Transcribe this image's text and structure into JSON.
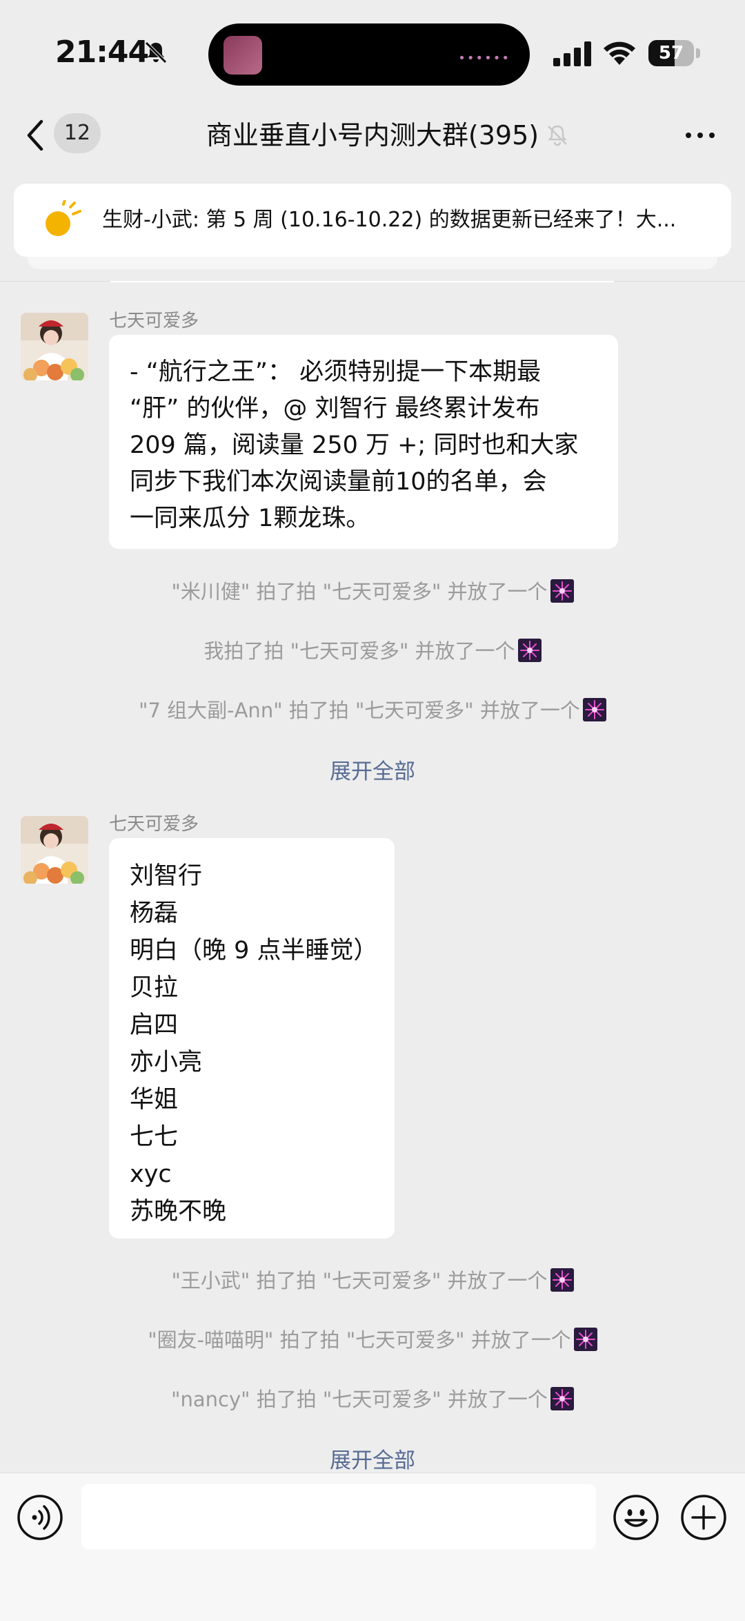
{
  "status_bar": {
    "time": "21:44",
    "battery": "57",
    "battery_level": 0.57
  },
  "nav": {
    "unread_count": "12",
    "title": "商业垂直小号内测大群(395)"
  },
  "pinned": {
    "text": "生财-小武: 第 5 周 (10.16-10.22) 的数据更新已经来了！大..."
  },
  "messages": [
    {
      "sender": "七天可爱多",
      "lines": [
        "- “航行之王”：  必须特别提一下本期最",
        "“肝” 的伙伴，@ 刘智行 最终累计发布",
        "209 篇，阅读量 250 万 +; 同时也和大家",
        "同步下我们本次阅读量前10的名单，会",
        "一同来瓜分 1颗龙珠。"
      ]
    },
    {
      "sender": "七天可爱多",
      "lines": [
        "刘智行",
        "杨磊",
        "明白（晚 9 点半睡觉）",
        "贝拉",
        "启四",
        "亦小亮",
        "华姐",
        "七七",
        "xyc",
        "苏晚不晚"
      ]
    }
  ],
  "system_group_1": [
    "\"米川健\" 拍了拍 \"七天可爱多\" 并放了一个",
    "我拍了拍 \"七天可爱多\" 并放了一个",
    "\"7 组大副-Ann\" 拍了拍 \"七天可爱多\" 并放了一个"
  ],
  "system_group_2": [
    "\"王小武\" 拍了拍 \"七天可爱多\" 并放了一个",
    "\"圈友-喵喵明\" 拍了拍 \"七天可爱多\" 并放了一个",
    "\"nancy\" 拍了拍 \"七天可爱多\" 并放了一个"
  ],
  "expand_label": "展开全部",
  "input": {
    "placeholder": ""
  },
  "colors": {
    "background": "#ededed",
    "link": "#576b95",
    "system_text": "#9b9b9b",
    "bubble": "#ffffff"
  }
}
